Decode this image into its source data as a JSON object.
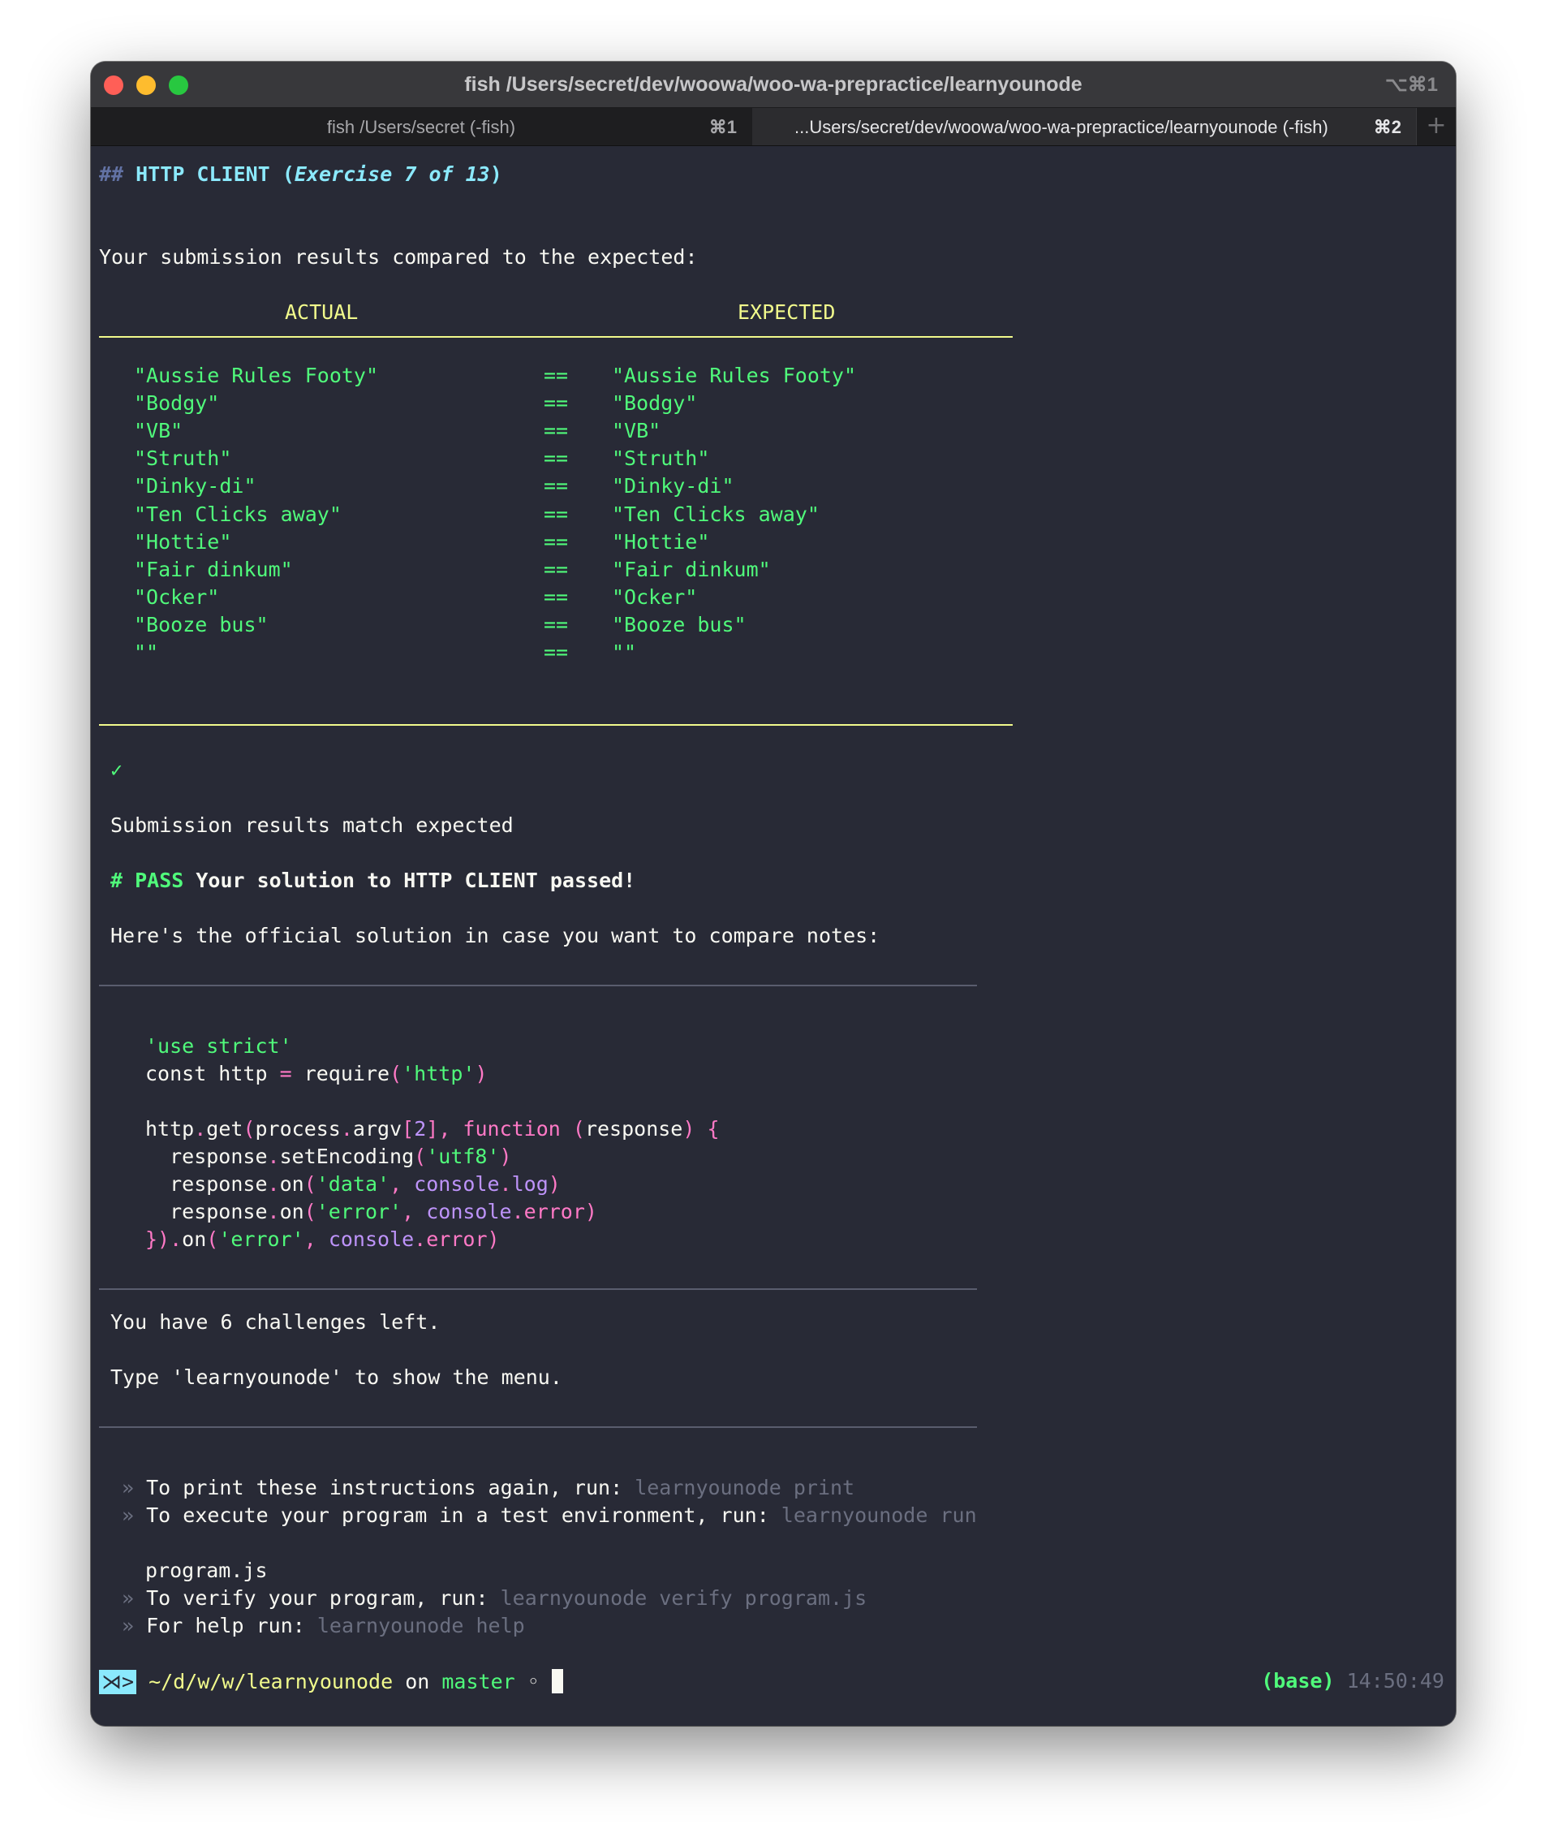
{
  "window": {
    "title": "fish /Users/secret/dev/woowa/woo-wa-prepractice/learnyounode",
    "shortcut": "⌥⌘1",
    "tabs": [
      {
        "label": "fish /Users/secret (-fish)",
        "shortcut": "⌘1"
      },
      {
        "label": "...Users/secret/dev/woowa/woo-wa-prepractice/learnyounode (-fish)",
        "shortcut": "⌘2"
      }
    ],
    "add_tab": "+"
  },
  "header": {
    "hashes": "##",
    "name": "HTTP CLIENT",
    "open_paren": "(",
    "exercise": "Exercise 7 of 13",
    "close_paren": ")"
  },
  "compare": {
    "intro": "Your submission results compared to the expected:",
    "col_actual": "ACTUAL",
    "col_expected": "EXPECTED",
    "op": "==",
    "rows": [
      {
        "actual": "\"Aussie Rules Footy\"",
        "expected": "\"Aussie Rules Footy\""
      },
      {
        "actual": "\"Bodgy\"",
        "expected": "\"Bodgy\""
      },
      {
        "actual": "\"VB\"",
        "expected": "\"VB\""
      },
      {
        "actual": "\"Struth\"",
        "expected": "\"Struth\""
      },
      {
        "actual": "\"Dinky-di\"",
        "expected": "\"Dinky-di\""
      },
      {
        "actual": "\"Ten Clicks away\"",
        "expected": "\"Ten Clicks away\""
      },
      {
        "actual": "\"Hottie\"",
        "expected": "\"Hottie\""
      },
      {
        "actual": "\"Fair dinkum\"",
        "expected": "\"Fair dinkum\""
      },
      {
        "actual": "\"Ocker\"",
        "expected": "\"Ocker\""
      },
      {
        "actual": "\"Booze bus\"",
        "expected": "\"Booze bus\""
      },
      {
        "actual": "\"\"",
        "expected": "\"\""
      }
    ]
  },
  "result": {
    "check": "✓",
    "match": "Submission results match expected",
    "pass_tag": "# PASS",
    "pass_msg": "Your solution to HTTP CLIENT passed!",
    "official": "Here's the official solution in case you want to compare notes:"
  },
  "code": {
    "l1": "'use strict'",
    "l2_a": "const http ",
    "l2_b": "=",
    "l2_c": " require",
    "l2_d": "(",
    "l2_e": "'http'",
    "l2_f": ")",
    "l3_a": "http",
    "l3_b": ".",
    "l3_c": "get",
    "l3_d": "(",
    "l3_e": "process",
    "l3_f": ".",
    "l3_g": "argv",
    "l3_h": "[",
    "l3_i": "2",
    "l3_j": "],",
    "l3_k": " function",
    "l3_l": " (",
    "l3_m": "response",
    "l3_n": ")",
    "l3_o": " {",
    "l4_a": "  response",
    "l4_b": ".",
    "l4_c": "setEncoding",
    "l4_d": "(",
    "l4_e": "'utf8'",
    "l4_f": ")",
    "l5_a": "  response",
    "l5_b": ".",
    "l5_c": "on",
    "l5_d": "(",
    "l5_e": "'data'",
    "l5_f": ", ",
    "l5_g": "console",
    "l5_h": ".",
    "l5_i": "log",
    "l5_j": ")",
    "l6_a": "  response",
    "l6_b": ".",
    "l6_c": "on",
    "l6_d": "(",
    "l6_e": "'error'",
    "l6_f": ", ",
    "l6_g": "console",
    "l6_h": ".",
    "l6_i": "error",
    "l6_j": ")",
    "l7_a": "})",
    "l7_b": ".",
    "l7_c": "on",
    "l7_d": "(",
    "l7_e": "'error'",
    "l7_f": ", ",
    "l7_g": "console",
    "l7_h": ".",
    "l7_i": "error",
    "l7_j": ")"
  },
  "footer": {
    "left": "You have 6 challenges left.",
    "menu": "Type 'learnyounode' to show the menu.",
    "bullet": "»",
    "print_text": "To print these instructions again, run: ",
    "print_cmd": "learnyounode print",
    "exec_text": "To execute your program in a test environment, run: ",
    "exec_cmd": "learnyounode run",
    "program": "program.js",
    "verify_text": "To verify your program, run: ",
    "verify_cmd": "learnyounode verify program.js",
    "help_text": "For help run: ",
    "help_cmd": "learnyounode help"
  },
  "prompt": {
    "badge": "⋊>",
    "path": "~/d/w/w/learnyounode",
    "on": " on ",
    "branch": "master",
    "dot": " ◦ ",
    "env": "(base)",
    "time": "14:50:49"
  },
  "colors": {
    "background": "#282a36",
    "green": "#50fa7b",
    "cyan": "#8be9fd",
    "yellow": "#f1fa8c",
    "pink": "#ff79c6",
    "purple": "#bd93f9"
  }
}
